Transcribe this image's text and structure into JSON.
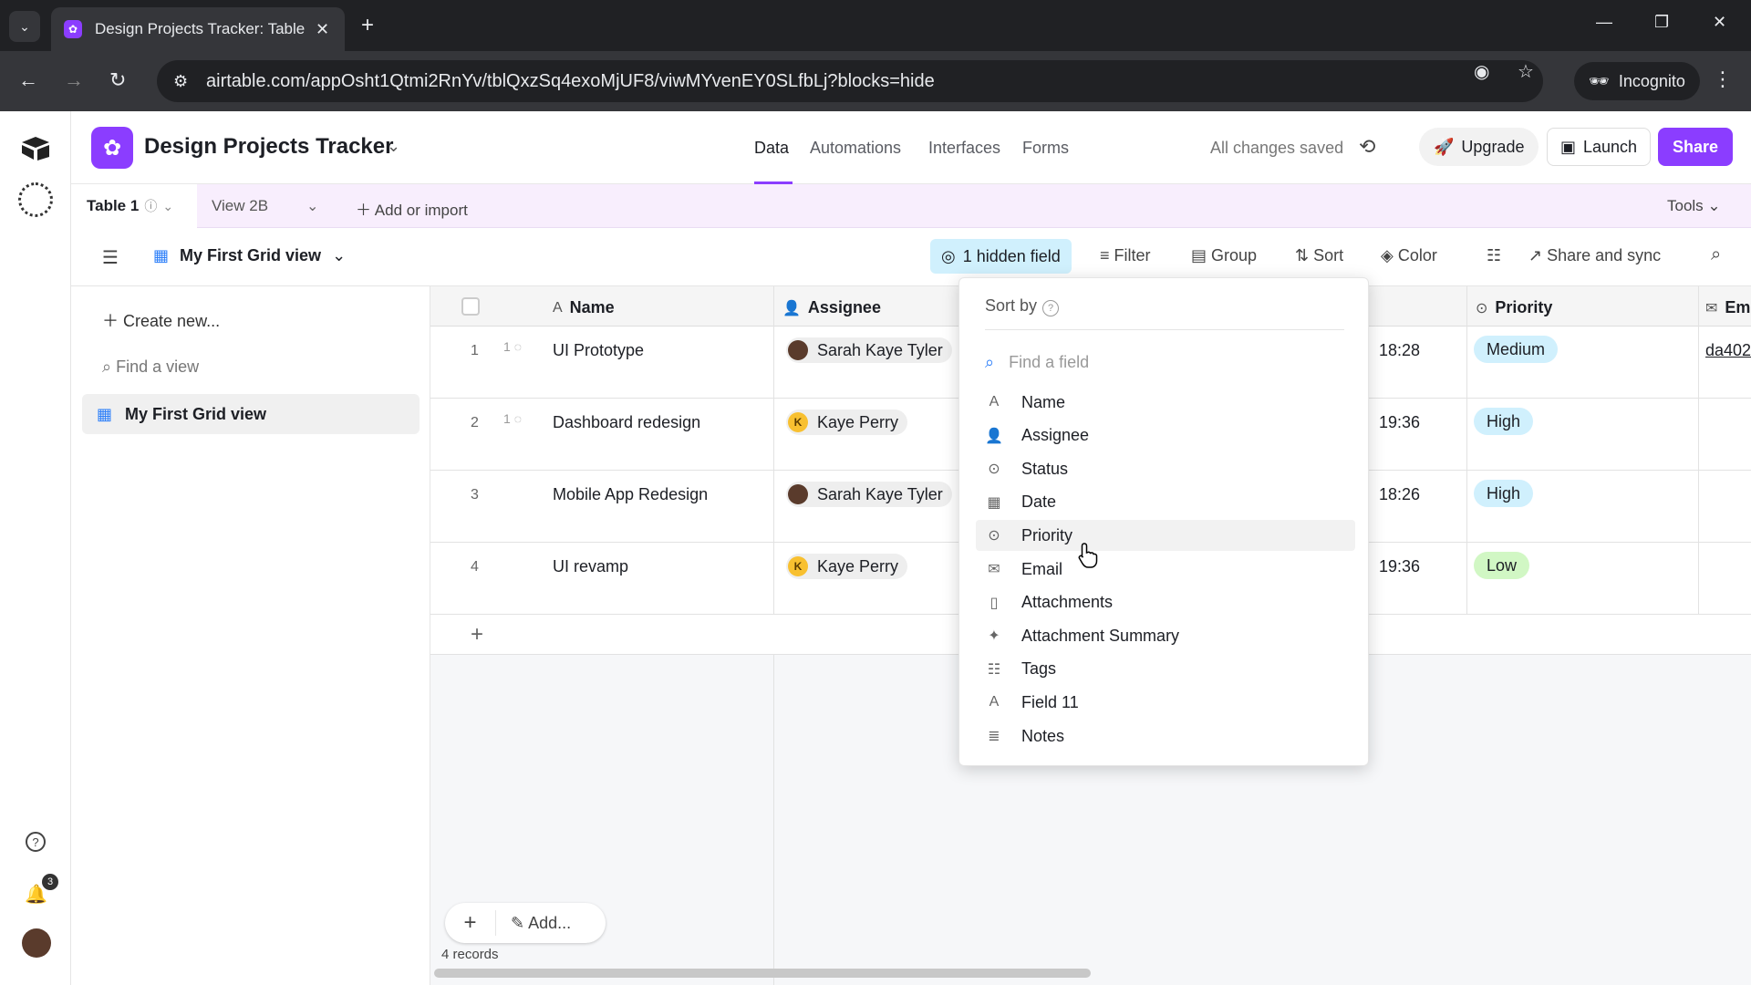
{
  "browser": {
    "tab_title": "Design Projects Tracker: Table 1",
    "url": "airtable.com/appOsht1Qtmi2RnYv/tblQxzSq4exoMjUF8/viwMYvenEY0SLfbLj?blocks=hide",
    "incognito_label": "Incognito"
  },
  "header": {
    "base_title": "Design Projects Tracker",
    "tabs": [
      "Data",
      "Automations",
      "Interfaces",
      "Forms"
    ],
    "saved_status": "All changes saved",
    "upgrade_label": "Upgrade",
    "launch_label": "Launch",
    "share_label": "Share"
  },
  "tables_bar": {
    "table_name": "Table 1",
    "view_tab": "View 2B",
    "add_import": "Add or import",
    "tools": "Tools"
  },
  "view_bar": {
    "view_name": "My First Grid view",
    "hidden_fields": "1 hidden field",
    "filter": "Filter",
    "group": "Group",
    "sort": "Sort",
    "color": "Color",
    "share_sync": "Share and sync"
  },
  "sidebar": {
    "create_new": "Create new...",
    "find_view_placeholder": "Find a view",
    "views": [
      "My First Grid view"
    ]
  },
  "notifications_count": "3",
  "grid": {
    "columns": {
      "name": "Name",
      "assignee": "Assignee",
      "priority": "Priority",
      "email": "Em"
    },
    "rows": [
      {
        "num": "1",
        "comments": "1",
        "name": "UI Prototype",
        "assignee": "Sarah Kaye Tyler",
        "avatar": "photo",
        "time": "18:28",
        "priority": "Medium",
        "priority_color": "#d0f0fd",
        "email": "da402"
      },
      {
        "num": "2",
        "comments": "1",
        "name": "Dashboard redesign",
        "assignee": "Kaye Perry",
        "avatar": "K",
        "time": "19:36",
        "priority": "High",
        "priority_color": "#d0f0fd",
        "email": ""
      },
      {
        "num": "3",
        "comments": "",
        "name": "Mobile App Redesign",
        "assignee": "Sarah Kaye Tyler",
        "avatar": "photo",
        "time": "18:26",
        "priority": "High",
        "priority_color": "#d0f0fd",
        "email": ""
      },
      {
        "num": "4",
        "comments": "",
        "name": "UI revamp",
        "assignee": "Kaye Perry",
        "avatar": "K",
        "time": "19:36",
        "priority": "Low",
        "priority_color": "#d1f7c4",
        "email": ""
      }
    ],
    "add_label": "Add...",
    "records_count": "4 records"
  },
  "sort_popover": {
    "title": "Sort by",
    "find_placeholder": "Find a field",
    "fields": [
      {
        "label": "Name",
        "icon": "text-icon"
      },
      {
        "label": "Assignee",
        "icon": "user-icon"
      },
      {
        "label": "Status",
        "icon": "single-select-icon"
      },
      {
        "label": "Date",
        "icon": "calendar-icon"
      },
      {
        "label": "Priority",
        "icon": "single-select-icon"
      },
      {
        "label": "Email",
        "icon": "mail-icon"
      },
      {
        "label": "Attachments",
        "icon": "file-icon"
      },
      {
        "label": "Attachment Summary",
        "icon": "ai-summary-icon"
      },
      {
        "label": "Tags",
        "icon": "multi-select-icon"
      },
      {
        "label": "Field 11",
        "icon": "text-icon"
      },
      {
        "label": "Notes",
        "icon": "long-text-icon"
      }
    ],
    "hovered_field": "Priority"
  },
  "colors": {
    "accent": "#8b3dff",
    "hidden_field_bg": "#d0f0fd",
    "tables_bar_bg": "#f8eefd"
  }
}
